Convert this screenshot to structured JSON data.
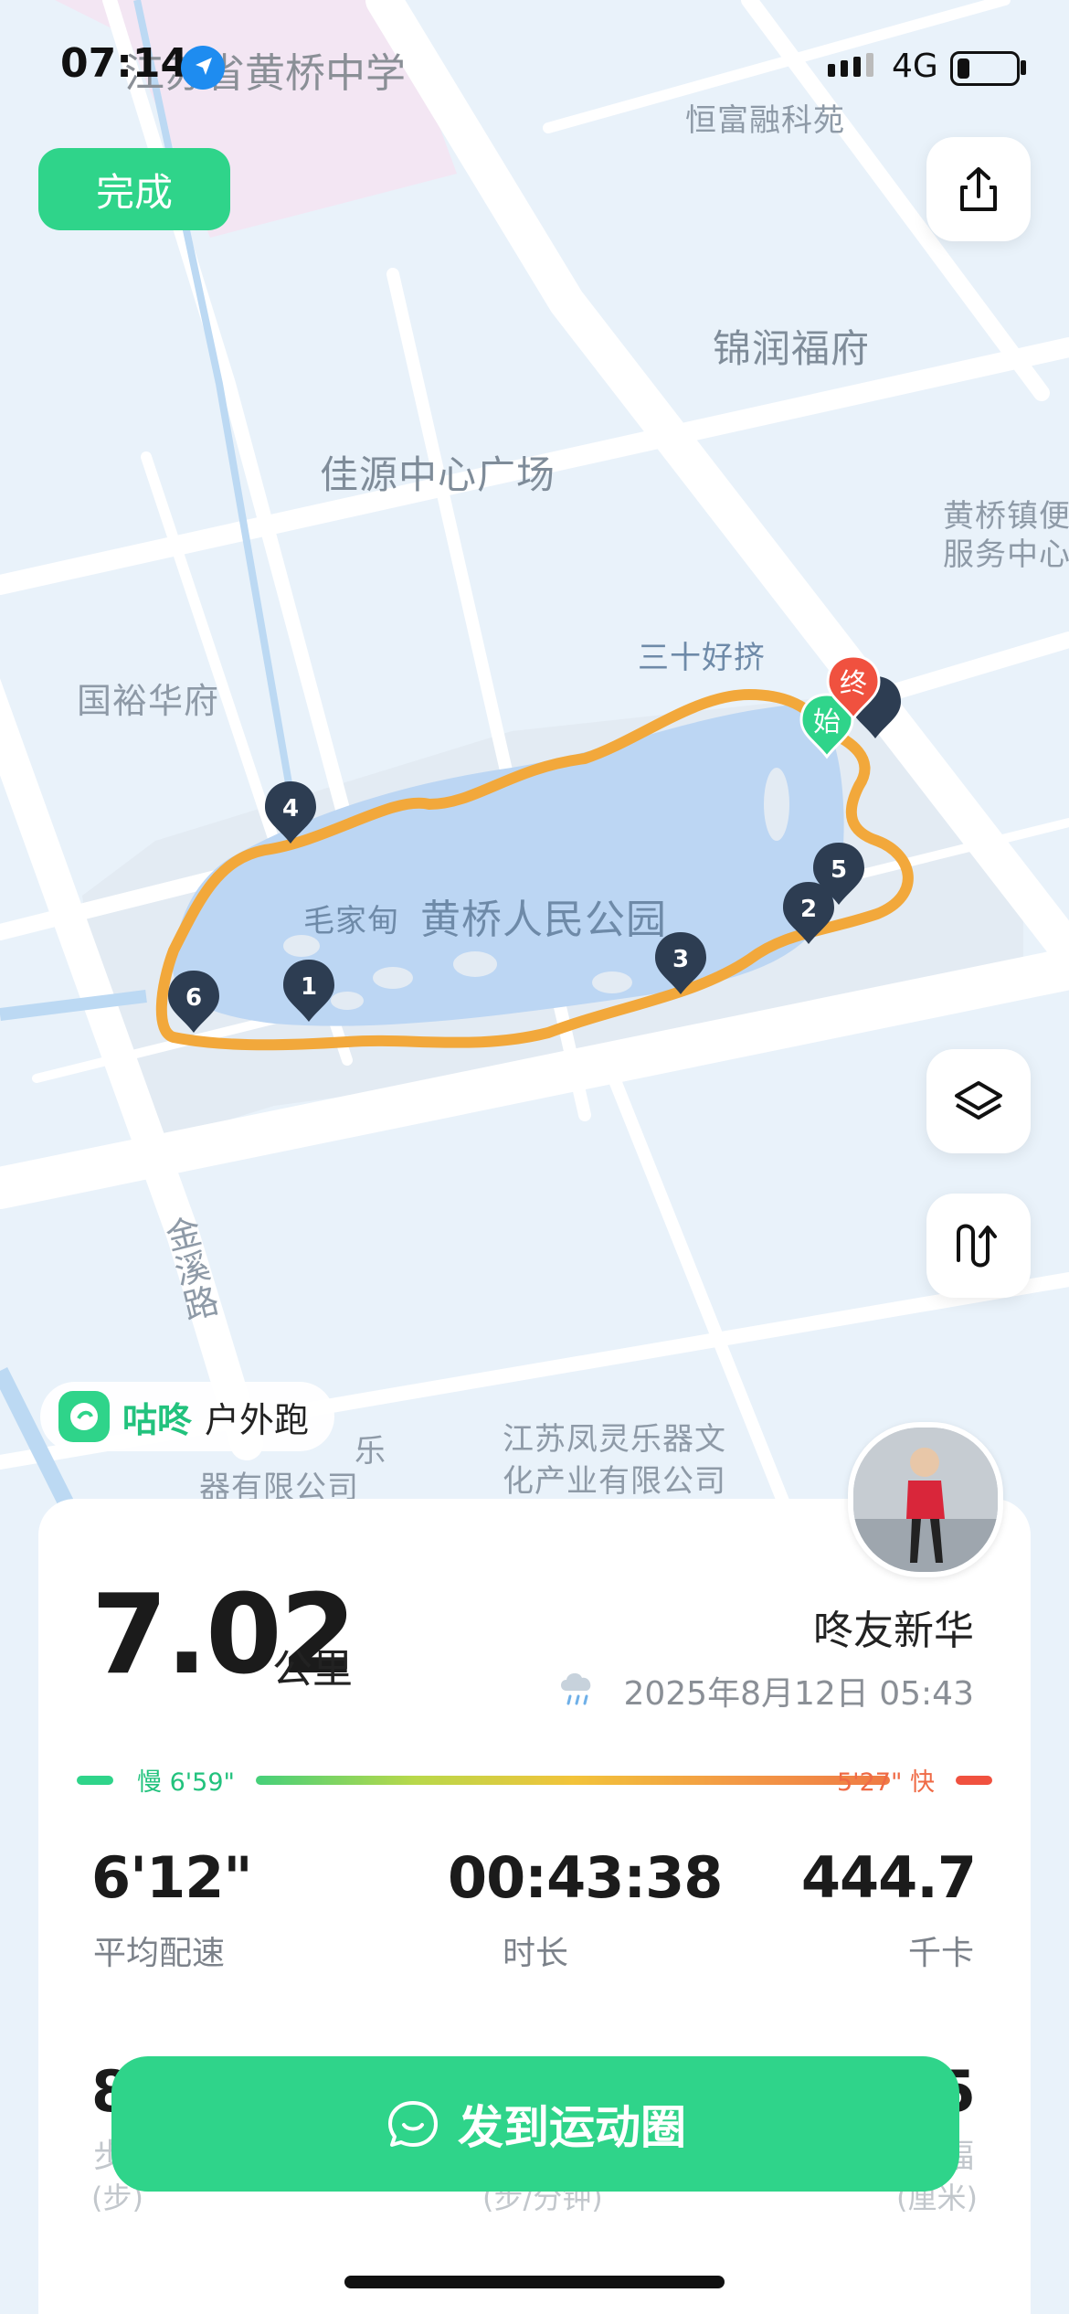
{
  "status_bar": {
    "time": "07:14",
    "location_text": "江苏省黄桥中学",
    "network": "4G"
  },
  "map": {
    "labels": {
      "hengfu": "恒富融科苑",
      "jinrun": "锦润福府",
      "jiayuan": "佳源中心广场",
      "huangqiaozhen": "黄桥镇便\n服务中心",
      "sanshi": "三十好挤",
      "guoyu": "国裕华府",
      "maojiadian": "毛家甸",
      "park": "黄桥人民公园",
      "jinxi": "金溪路",
      "fengling": "江苏凤灵乐器文\n化产业有限公司",
      "left_company": "器有限公司",
      "left_company_top": "乐"
    },
    "markers": {
      "start": "始",
      "end": "终",
      "km": [
        "1",
        "2",
        "3",
        "4",
        "5",
        "6"
      ]
    }
  },
  "buttons": {
    "done": "完成",
    "share": "发到运动圈"
  },
  "icons": {
    "share": "share-icon",
    "layers": "layers-icon",
    "route": "route-icon",
    "weather": "rain-cloud-icon",
    "chat": "chat-bubble-icon"
  },
  "badge": {
    "brand": "咕咚",
    "type": "户外跑"
  },
  "summary": {
    "distance": "7.02",
    "distance_unit": "公里",
    "username": "咚友新华",
    "datetime": "2025年8月12日 05:43"
  },
  "pace_legend": {
    "slow": "慢 6'59\"",
    "fast": "5'27\" 快"
  },
  "stats": [
    {
      "value": "6'12\"",
      "label": "平均配速"
    },
    {
      "value": "00:43:38",
      "label": "时长"
    },
    {
      "value": "444.7",
      "label": "千卡"
    }
  ],
  "stats_row2": {
    "left_value": "8",
    "left_label": "步",
    "left_sub": "(步)",
    "mid_sub": "(步/分钟)",
    "right_value": "5",
    "right_label": "幅",
    "right_sub": "(厘米)"
  },
  "colors": {
    "accent": "#2fd48a",
    "route": "#f2a83b",
    "slow": "#2fd48a",
    "fast": "#f0513f"
  }
}
